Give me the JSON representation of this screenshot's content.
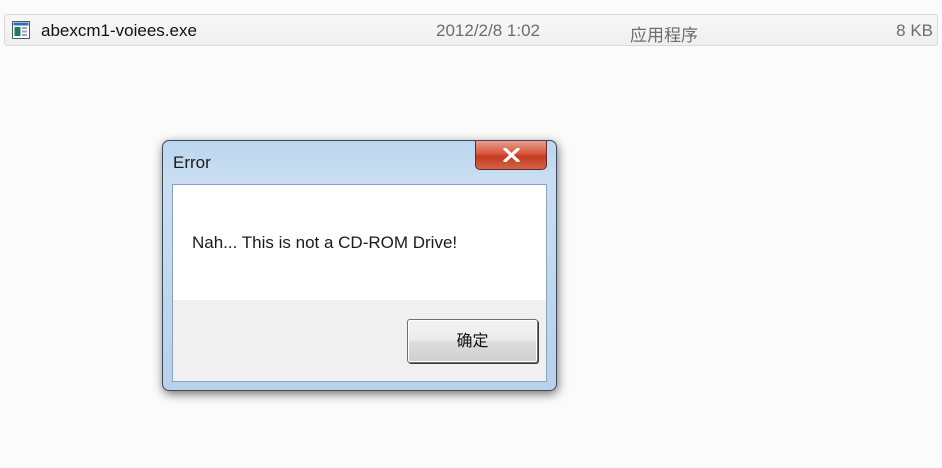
{
  "file_list": {
    "row": {
      "name": "abexcm1-voiees.exe",
      "date_modified": "2012/2/8 1:02",
      "type": "应用程序",
      "size": "8 KB",
      "icon": "executable-file-icon"
    }
  },
  "dialog": {
    "title": "Error",
    "message": "Nah... This is not a CD-ROM Drive!",
    "ok_label": "确定",
    "close_icon": "close-icon",
    "colors": {
      "close_button": "#c9452a",
      "title_bar": "#bcd6ee"
    }
  }
}
